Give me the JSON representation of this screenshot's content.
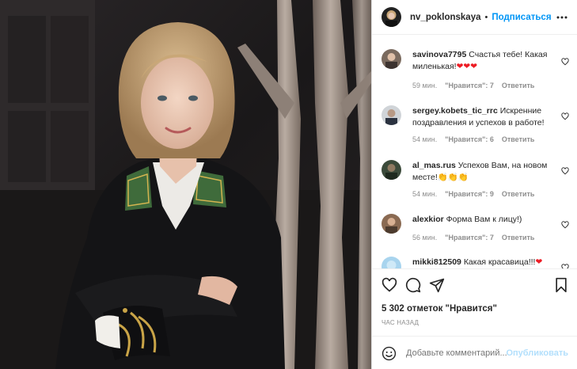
{
  "header": {
    "username": "nv_poklonskaya",
    "separator": "•",
    "follow_label": "Подписаться"
  },
  "comments": [
    {
      "username": "savinova7795",
      "text": "Счастья тебе! Какая миленькая!",
      "emoji": "❤❤❤",
      "time": "59 мин.",
      "likes": "\"Нравится\": 7",
      "reply": "Ответить"
    },
    {
      "username": "sergey.kobets_tic_rrc",
      "text": "Искренние поздравления и успехов в работе!",
      "time": "54 мин.",
      "likes": "\"Нравится\": 6",
      "reply": "Ответить"
    },
    {
      "username": "al_mas.rus",
      "text": "Успехов Вам, на новом месте!",
      "emoji": "👏👏👏",
      "time": "54 мин.",
      "likes": "\"Нравится\": 9",
      "reply": "Ответить"
    },
    {
      "username": "alexkior",
      "text": "Форма Вам к лицу!)",
      "time": "56 мин.",
      "likes": "\"Нравится\": 7",
      "reply": "Ответить"
    },
    {
      "username": "mikki812509",
      "text": "Какая красавица!!!",
      "emoji": "❤"
    }
  ],
  "likes_text": "5 302 отметок \"Нравится\"",
  "time_ago": "ЧАС НАЗАД",
  "add_comment": {
    "placeholder": "Добавьте комментарий...",
    "post_label": "Опубликовать"
  },
  "colors": {
    "link_blue": "#0095f6",
    "post_disabled": "#b2dffc",
    "meta_gray": "#8e8e8e",
    "heart_red": "#ed1c24"
  },
  "icons": [
    "more-options-icon",
    "heart-icon",
    "comment-icon",
    "share-icon",
    "bookmark-icon",
    "emoji-icon"
  ]
}
